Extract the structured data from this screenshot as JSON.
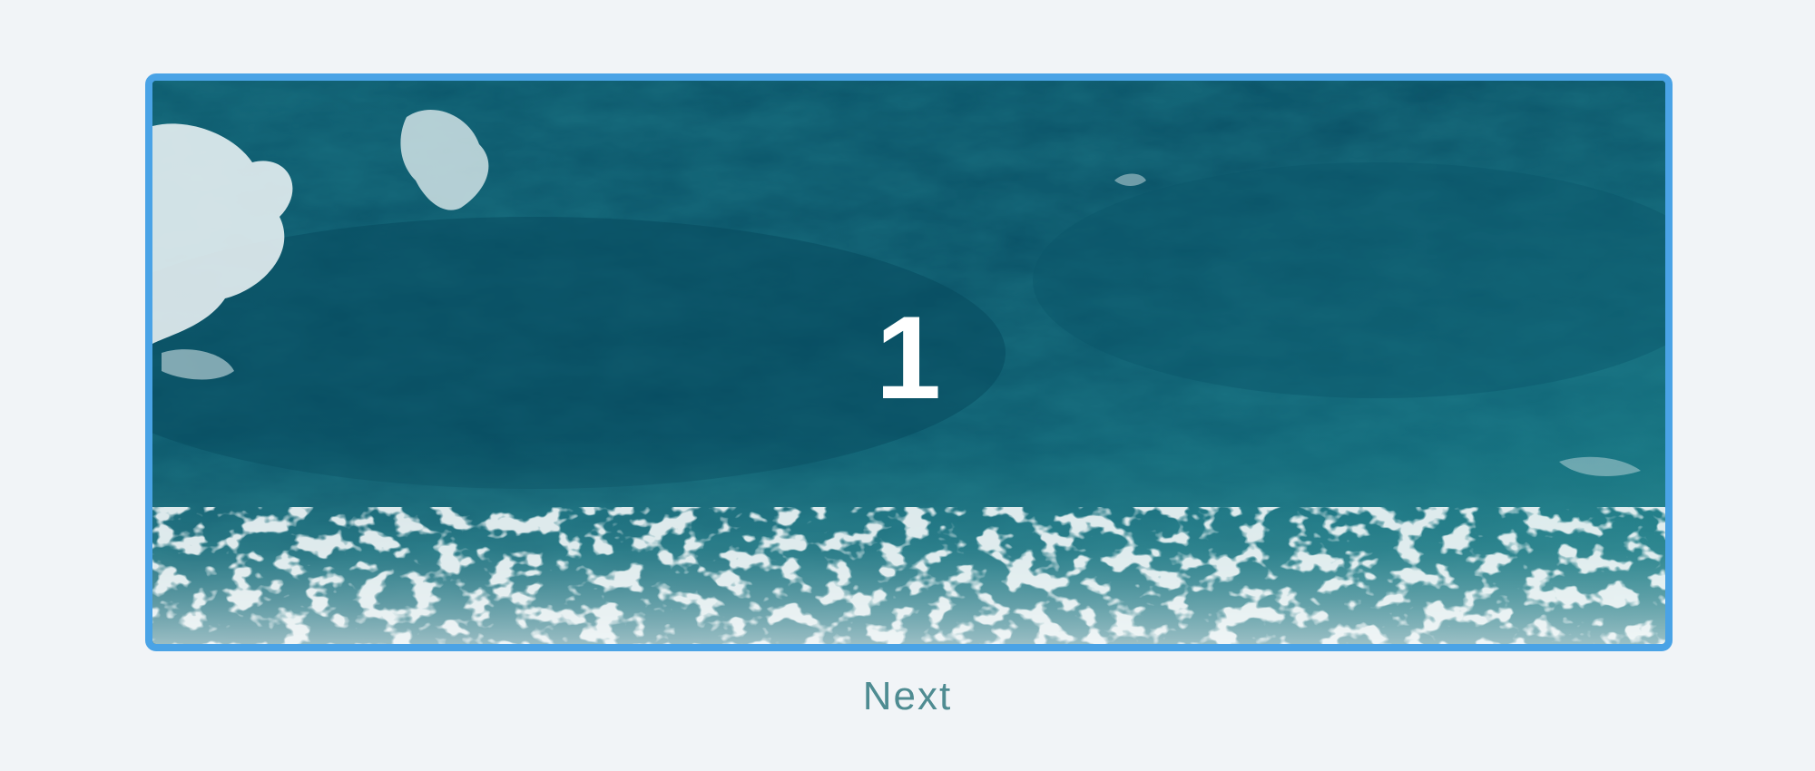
{
  "slider": {
    "current_slide": "1",
    "next_label": "Next",
    "background_image": "ocean-waves-aerial-image"
  },
  "colors": {
    "page_background": "#f1f4f7",
    "slider_border": "#4aa3e6",
    "slide_number": "#ffffff",
    "next_label": "#4f8c92"
  }
}
